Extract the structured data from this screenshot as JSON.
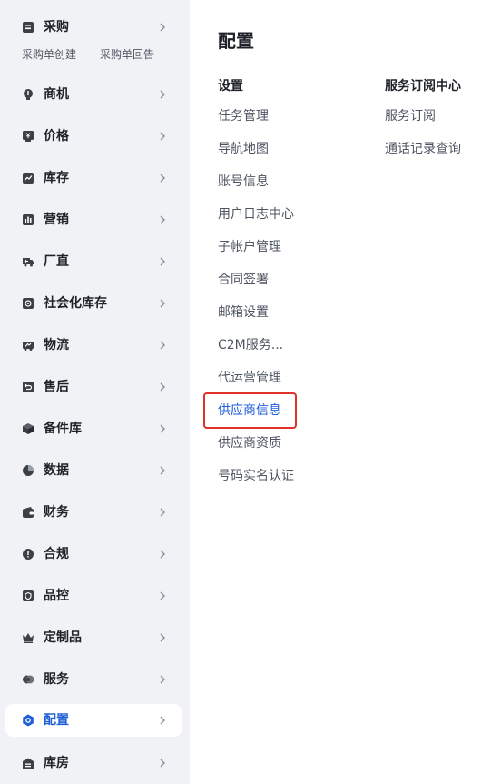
{
  "sidebar": {
    "items": [
      {
        "label": "采购",
        "icon": "purchase-icon",
        "sub": [
          "采购单创建",
          "采购单回告"
        ]
      },
      {
        "label": "商机",
        "icon": "lightbulb-icon"
      },
      {
        "label": "价格",
        "icon": "price-tag-icon"
      },
      {
        "label": "库存",
        "icon": "trend-chart-icon"
      },
      {
        "label": "营销",
        "icon": "bar-chart-icon"
      },
      {
        "label": "厂直",
        "icon": "truck-icon"
      },
      {
        "label": "社会化库存",
        "icon": "warehouse-box-icon"
      },
      {
        "label": "物流",
        "icon": "logistics-icon"
      },
      {
        "label": "售后",
        "icon": "return-icon"
      },
      {
        "label": "备件库",
        "icon": "cube-icon"
      },
      {
        "label": "数据",
        "icon": "pie-chart-icon"
      },
      {
        "label": "财务",
        "icon": "wallet-icon"
      },
      {
        "label": "合规",
        "icon": "alert-icon"
      },
      {
        "label": "品控",
        "icon": "shield-icon"
      },
      {
        "label": "定制品",
        "icon": "crown-icon"
      },
      {
        "label": "服务",
        "icon": "service-icon"
      },
      {
        "label": "配置",
        "icon": "hexagon-settings-icon",
        "active": true
      },
      {
        "label": "库房",
        "icon": "storehouse-icon"
      }
    ]
  },
  "main": {
    "title": "配置",
    "columns": [
      {
        "heading": "设置",
        "links": [
          "任务管理",
          "导航地图",
          "账号信息",
          "用户日志中心",
          "子帐户管理",
          "合同签署",
          "邮箱设置",
          "C2M服务...",
          "代运营管理",
          "供应商信息",
          "供应商资质",
          "号码实名认证"
        ]
      },
      {
        "heading": "服务订阅中心",
        "links": [
          "服务订阅",
          "通话记录查询"
        ]
      }
    ],
    "highlighted_link": "供应商信息"
  },
  "colors": {
    "active_text": "#1f5fd6",
    "highlight_border": "#e0312b",
    "sidebar_bg": "#f1f2f6"
  }
}
